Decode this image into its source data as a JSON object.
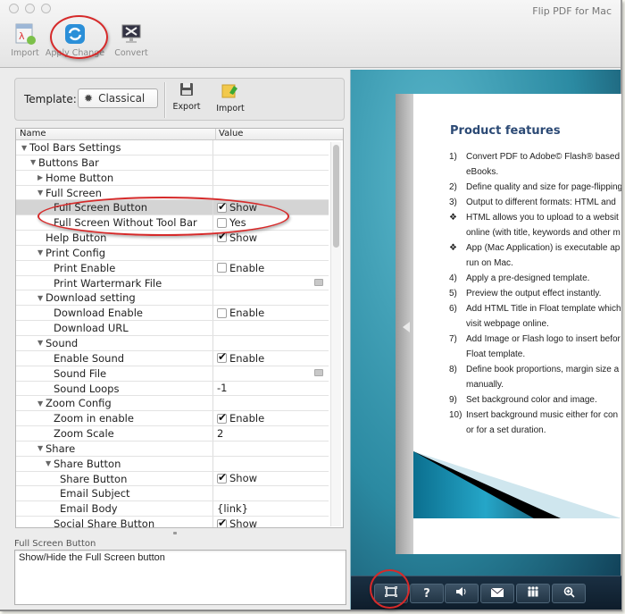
{
  "window": {
    "title": "Flip PDF for Mac"
  },
  "toolbar": {
    "buttons": [
      {
        "label": "Import",
        "icon": "import-pdf-icon"
      },
      {
        "label": "Apply Change",
        "icon": "apply-change-icon"
      },
      {
        "label": "Convert",
        "icon": "convert-icon"
      }
    ]
  },
  "template_bar": {
    "label": "Template:",
    "selected": "Classical",
    "export_label": "Export",
    "import_label": "Import"
  },
  "grid": {
    "columns": [
      "Name",
      "Value"
    ],
    "rows": [
      {
        "name": "Tool Bars Settings",
        "level": 0,
        "toggle": "open",
        "value": "",
        "type": "group"
      },
      {
        "name": "Buttons Bar",
        "level": 1,
        "toggle": "open",
        "value": "",
        "type": "group"
      },
      {
        "name": "Home Button",
        "level": 2,
        "toggle": "closed",
        "value": "",
        "type": "group"
      },
      {
        "name": "Full Screen",
        "level": 2,
        "toggle": "open",
        "value": "",
        "type": "group"
      },
      {
        "name": "Full Screen Button",
        "level": 3,
        "value": "Show",
        "type": "checkbox",
        "checked": true,
        "selected": true
      },
      {
        "name": "Full Screen Without Tool Bar",
        "level": 3,
        "value": "Yes",
        "type": "checkbox",
        "checked": false
      },
      {
        "name": "Help Button",
        "level": 2,
        "value": "Show",
        "type": "checkbox",
        "checked": true
      },
      {
        "name": "Print Config",
        "level": 2,
        "toggle": "open",
        "value": "",
        "type": "group"
      },
      {
        "name": "Print Enable",
        "level": 3,
        "value": "Enable",
        "type": "checkbox",
        "checked": false
      },
      {
        "name": "Print Wartermark File",
        "level": 3,
        "value": "",
        "type": "file"
      },
      {
        "name": "Download setting",
        "level": 2,
        "toggle": "open",
        "value": "",
        "type": "group"
      },
      {
        "name": "Download Enable",
        "level": 3,
        "value": "Enable",
        "type": "checkbox",
        "checked": false
      },
      {
        "name": "Download URL",
        "level": 3,
        "value": "",
        "type": "text"
      },
      {
        "name": "Sound",
        "level": 2,
        "toggle": "open",
        "value": "",
        "type": "group"
      },
      {
        "name": "Enable Sound",
        "level": 3,
        "value": "Enable",
        "type": "checkbox",
        "checked": true
      },
      {
        "name": "Sound File",
        "level": 3,
        "value": "",
        "type": "file"
      },
      {
        "name": "Sound Loops",
        "level": 3,
        "value": "-1",
        "type": "text"
      },
      {
        "name": "Zoom Config",
        "level": 2,
        "toggle": "open",
        "value": "",
        "type": "group"
      },
      {
        "name": "Zoom in enable",
        "level": 3,
        "value": "Enable",
        "type": "checkbox",
        "checked": true
      },
      {
        "name": "Zoom Scale",
        "level": 3,
        "value": "2",
        "type": "text"
      },
      {
        "name": "Share",
        "level": 2,
        "toggle": "open",
        "value": "",
        "type": "group"
      },
      {
        "name": "Share Button",
        "level": 3,
        "toggle": "open",
        "value": "",
        "type": "group"
      },
      {
        "name": "Share Button",
        "level": 4,
        "value": "Show",
        "type": "checkbox",
        "checked": true
      },
      {
        "name": "Email Subject",
        "level": 4,
        "value": "",
        "type": "text"
      },
      {
        "name": "Email Body",
        "level": 4,
        "value": "{link}",
        "type": "text"
      },
      {
        "name": "Social Share Button",
        "level": 3,
        "value": "Show",
        "type": "checkbox",
        "checked": true
      }
    ]
  },
  "description": {
    "title": "Full Screen Button",
    "text": "Show/Hide the Full Screen button"
  },
  "preview": {
    "page_title": "Product features",
    "lines": [
      {
        "num": "1)",
        "text": "Convert PDF to Adobe© Flash® based"
      },
      {
        "num": "",
        "text": "eBooks."
      },
      {
        "num": "2)",
        "text": "Define quality and size for page-flipping"
      },
      {
        "num": "3)",
        "text": "Output to different formats: HTML and"
      },
      {
        "num": "❖",
        "text": "HTML allows you to upload to a websit"
      },
      {
        "num": "",
        "text": "online (with title, keywords and other m"
      },
      {
        "num": "❖",
        "text": "App (Mac Application) is executable ap"
      },
      {
        "num": "",
        "text": "run on Mac."
      },
      {
        "num": "4)",
        "text": "Apply a pre-designed template."
      },
      {
        "num": "5)",
        "text": "Preview the output effect instantly."
      },
      {
        "num": "6)",
        "text": "Add HTML Title in Float template which"
      },
      {
        "num": "",
        "text": "visit webpage online."
      },
      {
        "num": "7)",
        "text": "Add Image or Flash logo to insert befor"
      },
      {
        "num": "",
        "text": "Float template."
      },
      {
        "num": "8)",
        "text": "Define book proportions, margin size a"
      },
      {
        "num": "",
        "text": "manually."
      },
      {
        "num": "9)",
        "text": "Set background color and image."
      },
      {
        "num": "10)",
        "text": "Insert background music either for con"
      },
      {
        "num": "",
        "text": "or for a set duration."
      }
    ],
    "bottom_buttons": [
      {
        "name": "fullscreen",
        "glyph": "⛶"
      },
      {
        "name": "help",
        "glyph": "?"
      },
      {
        "name": "sound",
        "glyph": "🔊"
      },
      {
        "name": "share-email",
        "glyph": "✉"
      },
      {
        "name": "social-share",
        "glyph": "👪"
      },
      {
        "name": "zoom-in",
        "glyph": "⊕"
      }
    ]
  },
  "colors": {
    "highlight_ring": "#d62a2a",
    "page_title": "#2c4a75",
    "preview_bg": "#2b8aa2"
  }
}
